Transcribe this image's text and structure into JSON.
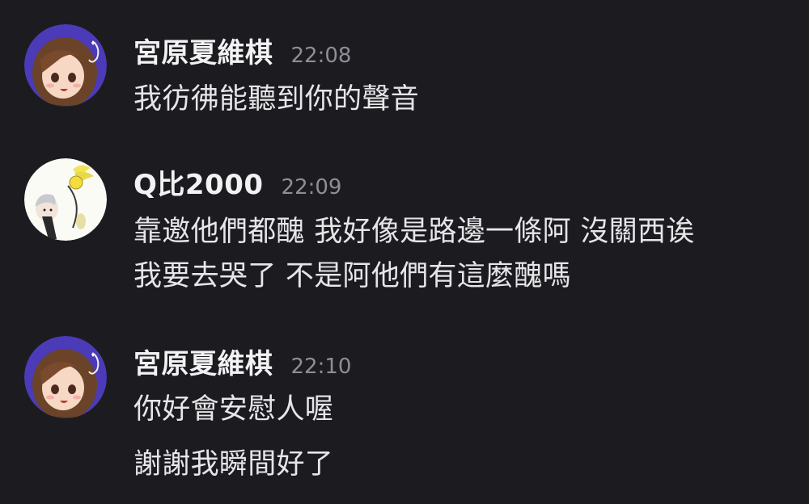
{
  "messages": [
    {
      "username": "宮原夏維棋",
      "time": "22:08",
      "avatar_icon": "anime-girl-avatar-icon",
      "lines": [
        "我彷彿能聽到你的聲音"
      ]
    },
    {
      "username": "Q比2000",
      "time": "22:09",
      "avatar_icon": "chibi-character-avatar-icon",
      "lines": [
        "靠邀他們都醜 我好像是路邊一條阿 沒關西诶",
        "我要去哭了 不是阿他們有這麼醜嗎"
      ]
    },
    {
      "username": "宮原夏維棋",
      "time": "22:10",
      "avatar_icon": "anime-girl-avatar-icon",
      "lines": [
        "你好會安慰人喔",
        "謝謝我瞬間好了"
      ]
    }
  ],
  "colors": {
    "background": "#1c1c20",
    "username": "#f2f2f4",
    "timestamp": "#8e8e96",
    "message_text": "#e6e6e9",
    "avatar_ring_purple": "#5a3fc0"
  }
}
